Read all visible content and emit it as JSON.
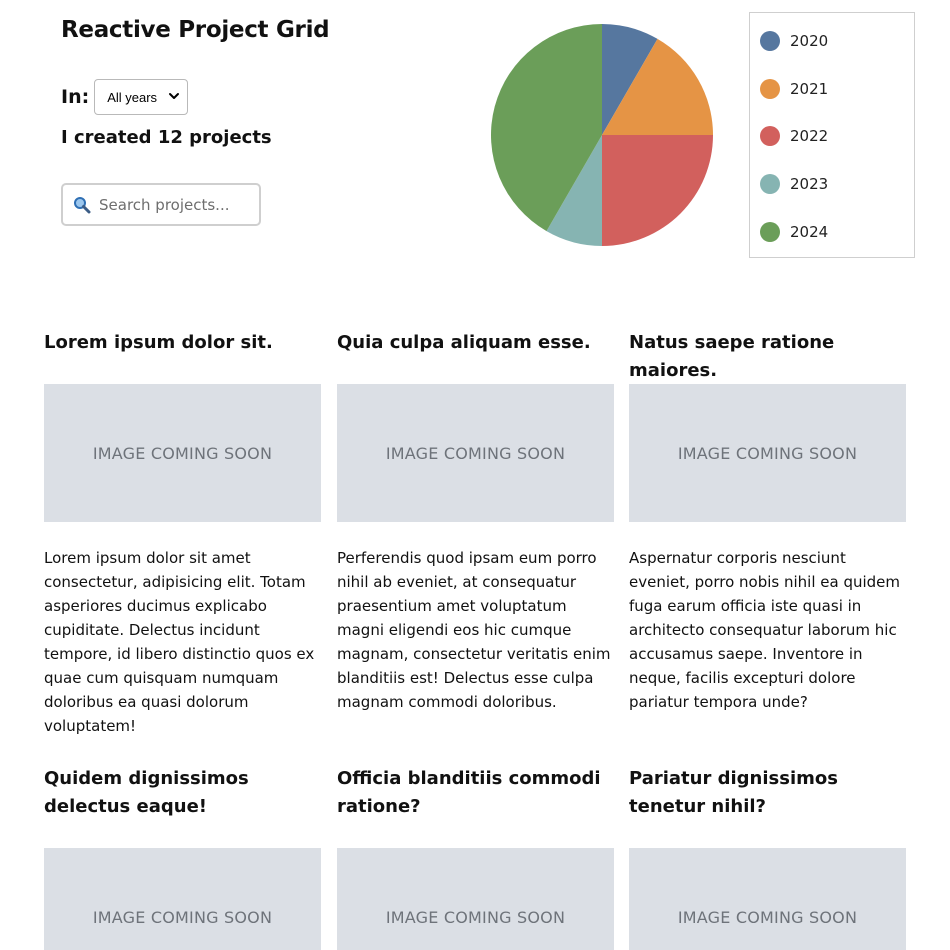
{
  "header": {
    "title": "Reactive Project Grid",
    "filter_label": "In:",
    "year_select_value": "All years",
    "project_count_text": "I created 12 projects",
    "search_placeholder": "Search projects..."
  },
  "chart_data": {
    "type": "pie",
    "slices": [
      {
        "label": "2020",
        "value": 1,
        "color": "#56779f"
      },
      {
        "label": "2021",
        "value": 2,
        "color": "#e59445"
      },
      {
        "label": "2022",
        "value": 3,
        "color": "#d2605d"
      },
      {
        "label": "2023",
        "value": 1,
        "color": "#86b4b2"
      },
      {
        "label": "2024",
        "value": 5,
        "color": "#6b9e59"
      }
    ],
    "legend_position": "right"
  },
  "projects": [
    {
      "title": "Lorem ipsum dolor sit.",
      "image_text": "IMAGE COMING SOON",
      "description": "Lorem ipsum dolor sit amet consectetur, adipisicing elit. Totam asperiores ducimus explicabo cupiditate. Delectus incidunt tempore, id libero distinctio quos ex quae cum quisquam numquam doloribus ea quasi dolorum voluptatem!"
    },
    {
      "title": "Quia culpa aliquam esse.",
      "image_text": "IMAGE COMING SOON",
      "description": "Perferendis quod ipsam eum porro nihil ab eveniet, at consequatur praesentium amet voluptatum magni eligendi eos hic cumque magnam, consectetur veritatis enim blanditiis est! Delectus esse culpa magnam commodi doloribus."
    },
    {
      "title": "Natus saepe ratione maiores.",
      "image_text": "IMAGE COMING SOON",
      "description": "Aspernatur corporis nesciunt eveniet, porro nobis nihil ea quidem fuga earum officia iste quasi in architecto consequatur laborum hic accusamus saepe. Inventore in neque, facilis excepturi dolore pariatur tempora unde?"
    },
    {
      "title": "Quidem dignissimos delectus eaque!",
      "image_text": "IMAGE COMING SOON",
      "description": ""
    },
    {
      "title": "Officia blanditiis commodi ratione?",
      "image_text": "IMAGE COMING SOON",
      "description": ""
    },
    {
      "title": "Pariatur dignissimos tenetur nihil?",
      "image_text": "IMAGE COMING SOON",
      "description": ""
    }
  ]
}
